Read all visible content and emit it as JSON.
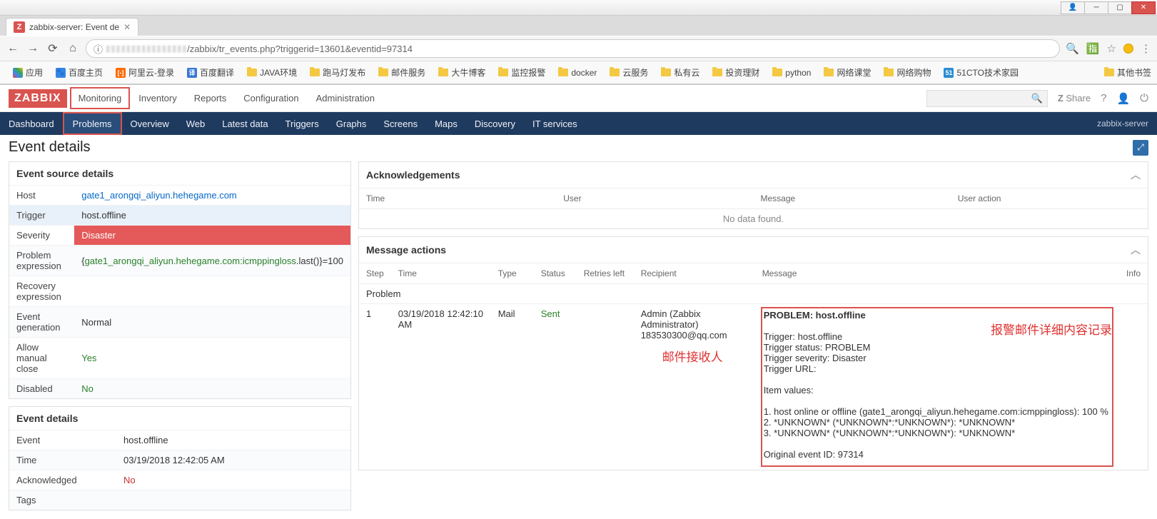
{
  "browser": {
    "tab_title": "zabbix-server: Event de",
    "url_path": "/zabbix/tr_events.php?triggerid=13601&eventid=97314"
  },
  "bookmarks": {
    "apps": "应用",
    "items": [
      "百度主页",
      "阿里云-登录",
      "百度翻译",
      "JAVA环境",
      "跑马灯发布",
      "邮件服务",
      "大牛博客",
      "监控报警",
      "docker",
      "云服务",
      "私有云",
      "投资理财",
      "python",
      "网络课堂",
      "网络购物",
      "51CTO技术家园"
    ],
    "other": "其他书签"
  },
  "zbx": {
    "logo": "ZABBIX",
    "menu": [
      "Monitoring",
      "Inventory",
      "Reports",
      "Configuration",
      "Administration"
    ],
    "share": "Share",
    "sub": [
      "Dashboard",
      "Problems",
      "Overview",
      "Web",
      "Latest data",
      "Triggers",
      "Graphs",
      "Screens",
      "Maps",
      "Discovery",
      "IT services"
    ],
    "server": "zabbix-server"
  },
  "page": {
    "title": "Event details"
  },
  "source": {
    "title": "Event source details",
    "host_k": "Host",
    "host_v": "gate1_arongqi_aliyun.hehegame.com",
    "trigger_k": "Trigger",
    "trigger_v": "host.offline",
    "severity_k": "Severity",
    "severity_v": "Disaster",
    "pexpr_k": "Problem expression",
    "pexpr_pre": "{",
    "pexpr_link": "gate1_arongqi_aliyun.hehegame.com:icmppingloss",
    "pexpr_post": ".last()}=100",
    "rexpr_k": "Recovery expression",
    "rexpr_v": "",
    "evgen_k": "Event generation",
    "evgen_v": "Normal",
    "manual_k": "Allow manual close",
    "manual_v": "Yes",
    "disabled_k": "Disabled",
    "disabled_v": "No"
  },
  "details": {
    "title": "Event details",
    "event_k": "Event",
    "event_v": "host.offline",
    "time_k": "Time",
    "time_v": "03/19/2018 12:42:05 AM",
    "ack_k": "Acknowledged",
    "ack_v": "No",
    "tags_k": "Tags",
    "tags_v": ""
  },
  "ack": {
    "title": "Acknowledgements",
    "cols": [
      "Time",
      "User",
      "Message",
      "User action"
    ],
    "nodata": "No data found."
  },
  "msg": {
    "title": "Message actions",
    "cols": [
      "Step",
      "Time",
      "Type",
      "Status",
      "Retries left",
      "Recipient",
      "Message",
      "Info"
    ],
    "section": "Problem",
    "row": {
      "step": "1",
      "time": "03/19/2018 12:42:10 AM",
      "type": "Mail",
      "status": "Sent",
      "retries": "",
      "recipient_name": "Admin (Zabbix Administrator)",
      "recipient_mail": "183530300@qq.com",
      "msg_title": "PROBLEM: host.offline",
      "lines": [
        "Trigger: host.offline",
        "Trigger status: PROBLEM",
        "Trigger severity: Disaster",
        "Trigger URL:",
        "",
        "Item values:",
        "",
        "1. host online or offline (gate1_arongqi_aliyun.hehegame.com:icmppingloss): 100 %",
        "2. *UNKNOWN* (*UNKNOWN*:*UNKNOWN*): *UNKNOWN*",
        "3. *UNKNOWN* (*UNKNOWN*:*UNKNOWN*): *UNKNOWN*",
        "",
        "Original event ID: 97314"
      ]
    }
  },
  "annotations": {
    "recipient": "邮件接收人",
    "message": "报警邮件详细内容记录"
  }
}
